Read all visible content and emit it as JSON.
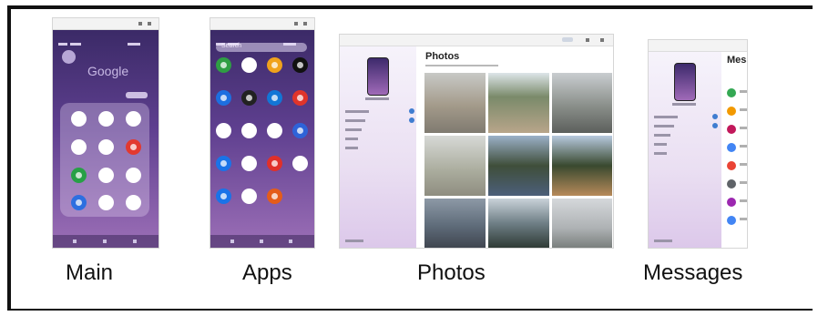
{
  "captions": {
    "main": "Main",
    "apps": "Apps",
    "photos": "Photos",
    "messages": "Messages"
  },
  "main_screen": {
    "search_brand": "Google",
    "app_icon_colors": [
      "#ffffff",
      "#ffffff",
      "#ffffff",
      "#ffffff",
      "#ffffff",
      "#e2392f",
      "#27a046",
      "#ffffff",
      "#ffffff",
      "#2d6fe0",
      "#ffffff",
      "#ffffff"
    ]
  },
  "apps_screen": {
    "search_placeholder": "Search",
    "app_icon_colors": [
      "#2f9e44",
      "#ffffff",
      "#f0a21c",
      "#111111",
      "#1d6fe0",
      "#222222",
      "#1276d6",
      "#e0342a",
      "#ffffff",
      "#ffffff",
      "#ffffff",
      "#2e63d8",
      "#1a73e8",
      "#ffffff",
      "#e0302a",
      "#ffffff",
      "#1a73e8",
      "#ffffff",
      "#e45c1a"
    ]
  },
  "photos_window": {
    "page_title": "Photos",
    "sidebar_items": [
      "",
      "",
      "",
      "",
      "",
      ""
    ]
  },
  "messages_window": {
    "page_title": "Mess",
    "avatar_colors": [
      "#34a853",
      "#f29900",
      "#c2185b",
      "#4285f4",
      "#ea4335",
      "#5f6368",
      "#9c27b0",
      "#4285f4"
    ]
  },
  "colors": {
    "phone_top": "#3b2a67",
    "phone_bottom": "#9c6fb7",
    "frame_border": "#111111"
  }
}
